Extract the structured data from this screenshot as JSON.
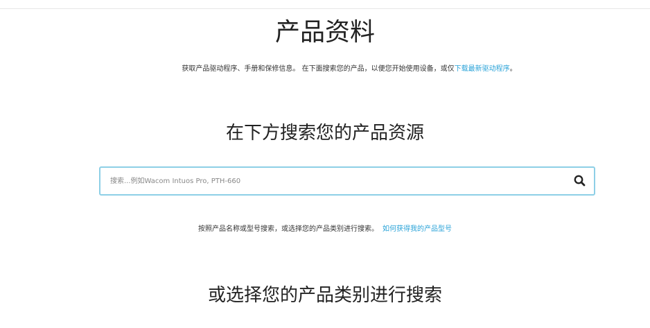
{
  "header": {
    "title": "产品资料"
  },
  "intro": {
    "text": "获取产品驱动程序、手册和保修信息。 在下面搜索您的产品，以便您开始使用设备，或仅",
    "link_text": "下载最新驱动程序",
    "suffix": "。"
  },
  "search": {
    "heading": "在下方搜索您的产品资源",
    "placeholder": "搜索...例如Wacom Intuos Pro, PTH-660",
    "value": "",
    "icon": "search-icon"
  },
  "helper": {
    "text": "按照产品名称或型号搜索，或选择您的产品类别进行搜索。",
    "link_text": "如何获得我的产品型号"
  },
  "categories": {
    "heading": "或选择您的产品类别进行搜索"
  }
}
